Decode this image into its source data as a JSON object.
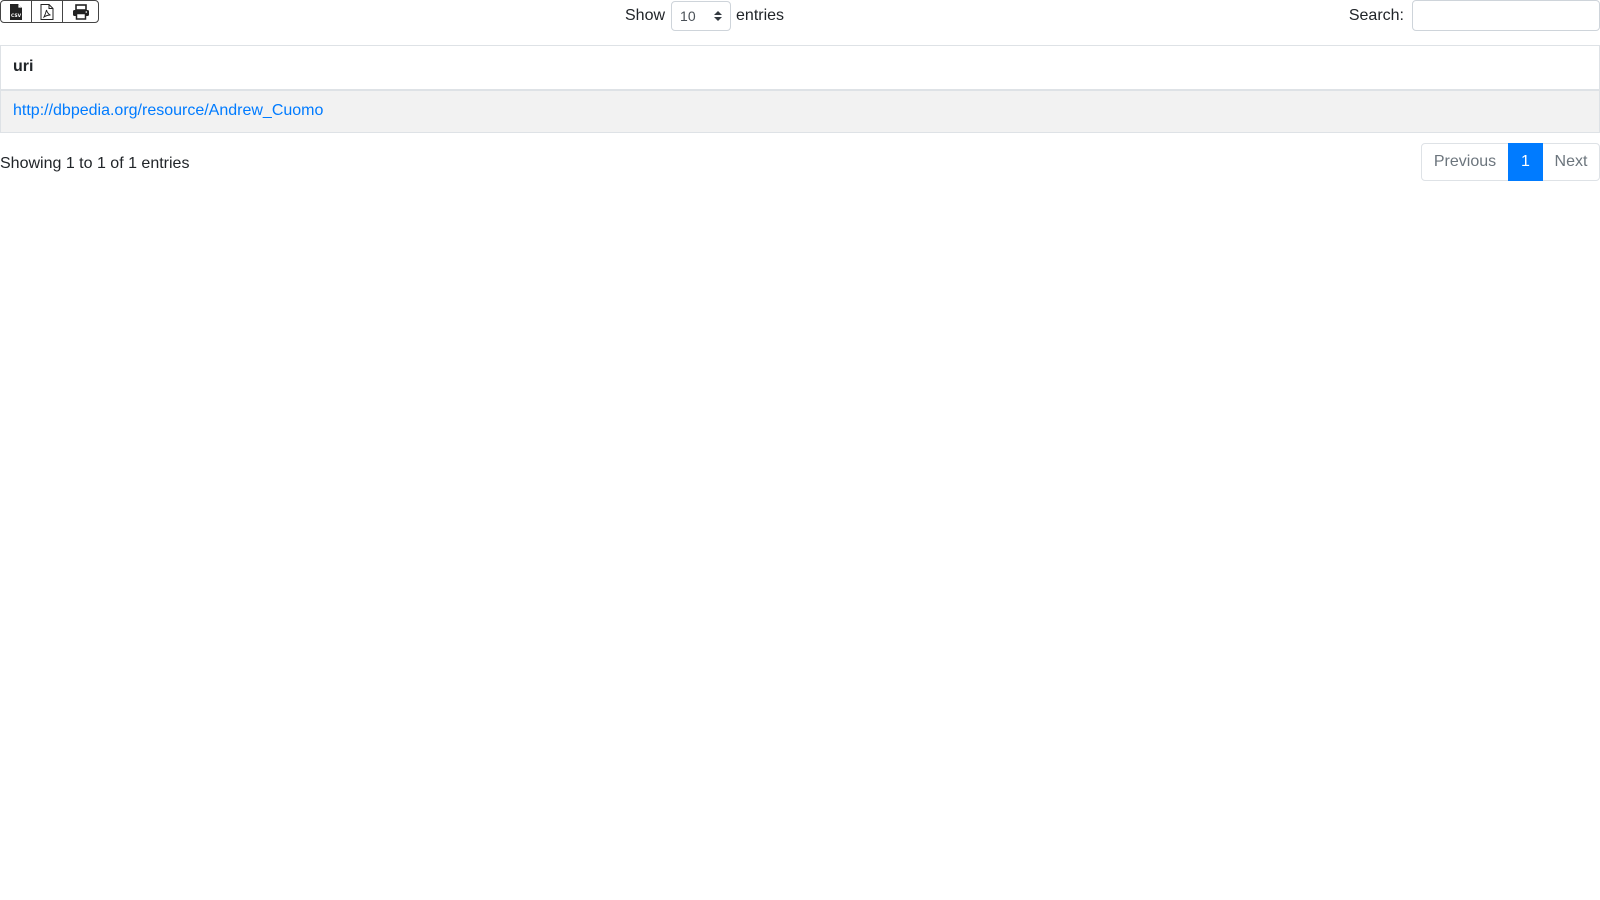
{
  "toolbar": {
    "export_buttons": [
      {
        "icon": "csv-file-icon"
      },
      {
        "icon": "pdf-file-icon"
      },
      {
        "icon": "print-icon"
      }
    ]
  },
  "length": {
    "show_label": "Show",
    "selected": "10",
    "entries_label": "entries"
  },
  "search": {
    "label": "Search:",
    "value": "",
    "placeholder": ""
  },
  "table": {
    "columns": [
      "uri"
    ],
    "rows": [
      [
        "http://dbpedia.org/resource/Andrew_Cuomo"
      ]
    ]
  },
  "info": {
    "text": "Showing 1 to 1 of 1 entries"
  },
  "pagination": {
    "previous": "Previous",
    "current": "1",
    "next": "Next"
  },
  "colors": {
    "accent": "#007bff",
    "row_stripe": "#f2f2f2",
    "border": "#dee2e6"
  }
}
